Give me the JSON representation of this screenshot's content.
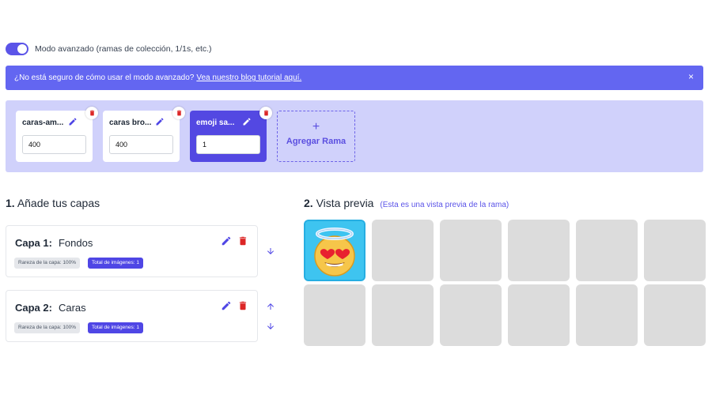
{
  "advanced_toggle": {
    "label": "Modo avanzado (ramas de colección, 1/1s, etc.)",
    "on": true
  },
  "banner": {
    "text": "¿No está seguro de cómo usar el modo avanzado?",
    "link": "Vea nuestro blog tutorial aquí.",
    "close": "×"
  },
  "branches": [
    {
      "name": "caras-am...",
      "value": "400",
      "active": false
    },
    {
      "name": "caras bro...",
      "value": "400",
      "active": false
    },
    {
      "name": "emoji sa...",
      "value": "1",
      "active": true
    }
  ],
  "add_branch": {
    "plus": "+",
    "label": "Agregar Rama"
  },
  "section1": {
    "number": "1.",
    "title": "Añade tus capas"
  },
  "layers": [
    {
      "label": "Capa 1:",
      "name": "Fondos",
      "rarity": "Rareza de la capa: 100%",
      "total": "Total de imágenes: 1"
    },
    {
      "label": "Capa 2:",
      "name": "Caras",
      "rarity": "Rareza de la capa: 100%",
      "total": "Total de imágenes: 1"
    }
  ],
  "section2": {
    "number": "2.",
    "title": "Vista previa",
    "subtitle": "(Esta es una vista previa de la rama)"
  },
  "preview": {
    "tile_count": 12,
    "first_tile": "heart-eyes-angel-emoji"
  },
  "colors": {
    "accent": "#5b54e8",
    "banner": "#6366f1",
    "branch_panel": "#d0d1fb",
    "delete": "#dc2626"
  }
}
